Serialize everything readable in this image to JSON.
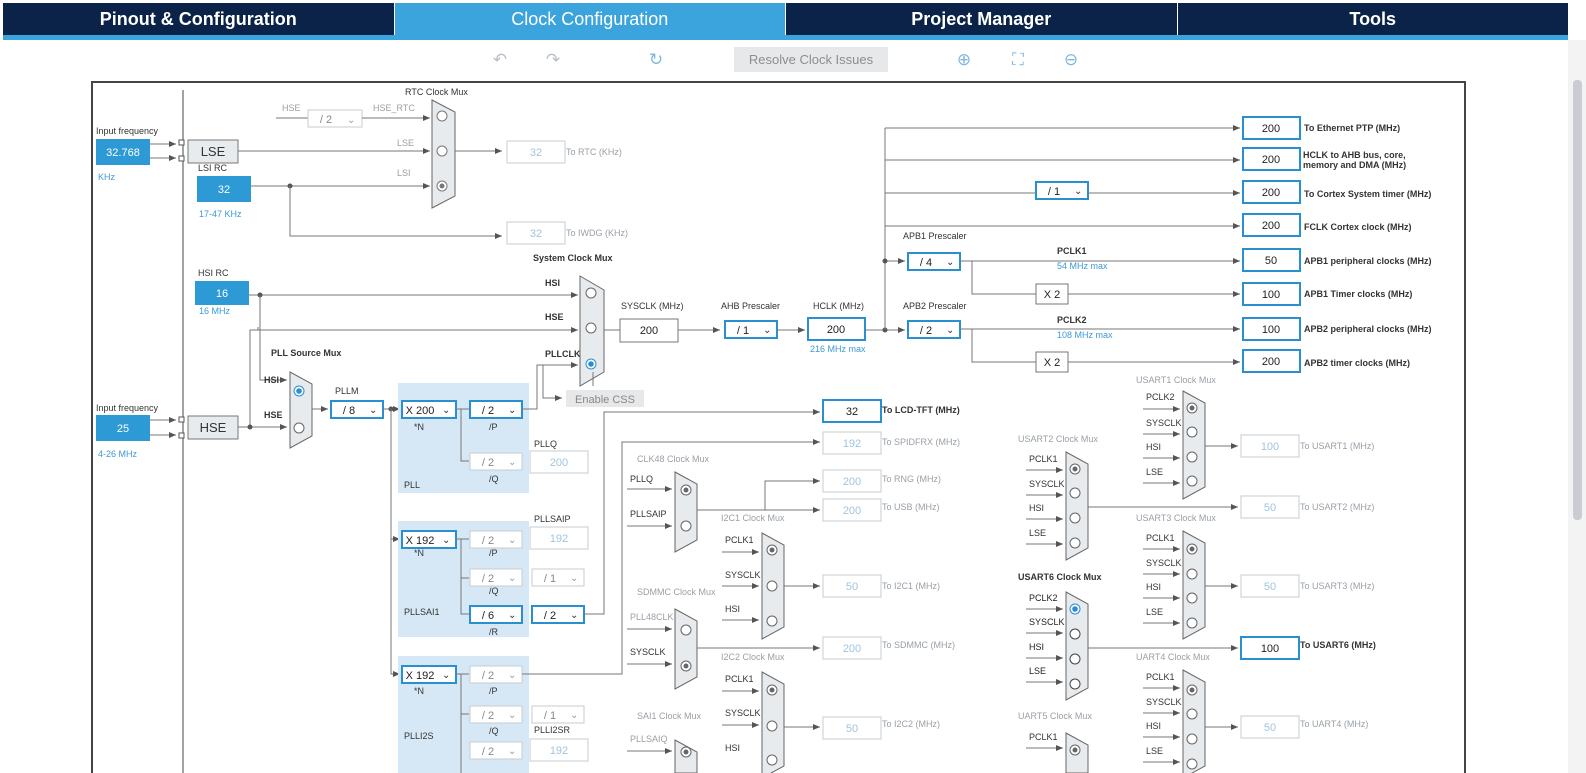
{
  "tabs": [
    "Pinout & Configuration",
    "Clock Configuration",
    "Project Manager",
    "Tools"
  ],
  "toolbar": {
    "resolve_label": "Resolve Clock Issues"
  },
  "colors": {
    "accent": "#3ba4dc",
    "nav": "#0b2349",
    "box_active": "#2a8fd0"
  },
  "sources": {
    "input_freq_label": "Input frequency",
    "lse": {
      "value": "32.768",
      "unit": "KHz",
      "label": "LSE"
    },
    "lsi": {
      "label": "LSI RC",
      "value": "32",
      "range": "17-47 KHz"
    },
    "hsi": {
      "label": "HSI RC",
      "value": "16",
      "range": "16 MHz"
    },
    "hse": {
      "value": "25",
      "range": "4-26 MHz",
      "label": "HSE"
    }
  },
  "rtc": {
    "title": "RTC Clock Mux",
    "hse": "HSE",
    "hse_div": "/ 2",
    "hse_rtc": "HSE_RTC",
    "lse": "LSE",
    "lsi": "LSI",
    "out": "32",
    "out_label": "To RTC (KHz)",
    "iwdg": "32",
    "iwdg_label": "To IWDG (KHz)"
  },
  "sysmux": {
    "title": "System Clock Mux",
    "hsi": "HSI",
    "hse": "HSE",
    "pllclk": "PLLCLK",
    "sysclk_label": "SYSCLK (MHz)",
    "sysclk": "200",
    "css": "Enable CSS"
  },
  "ahb": {
    "label": "AHB Prescaler",
    "div": "/ 1",
    "hclk_label": "HCLK (MHz)",
    "hclk": "200",
    "max": "216 MHz max"
  },
  "apb1": {
    "label": "APB1 Prescaler",
    "div": "/ 4",
    "pclk": "PCLK1",
    "max": "54 MHz max",
    "x2": "X 2"
  },
  "apb2": {
    "label": "APB2 Prescaler",
    "div": "/ 2",
    "pclk": "PCLK2",
    "max": "108 MHz max",
    "x2": "X 2"
  },
  "cortex_div": "/ 1",
  "outputs": [
    {
      "value": "200",
      "label": "To Ethernet PTP (MHz)"
    },
    {
      "value": "200",
      "label": "HCLK to AHB bus, core, memory and DMA (MHz)"
    },
    {
      "value": "200",
      "label": "To Cortex System timer (MHz)"
    },
    {
      "value": "200",
      "label": "FCLK Cortex clock (MHz)"
    },
    {
      "value": "50",
      "label": "APB1 peripheral clocks (MHz)"
    },
    {
      "value": "100",
      "label": "APB1 Timer clocks (MHz)"
    },
    {
      "value": "100",
      "label": "APB2 peripheral clocks (MHz)"
    },
    {
      "value": "200",
      "label": "APB2 timer clocks (MHz)"
    }
  ],
  "pll": {
    "src_title": "PLL Source Mux",
    "hsi": "HSI",
    "hse": "HSE",
    "pllm_label": "PLLM",
    "pllm": "/ 8",
    "n": "X 200",
    "n_lab": "*N",
    "p": "/ 2",
    "p_lab": "/P",
    "q": "/ 2",
    "q_lab": "/Q",
    "plllq": "PLLQ",
    "plllq_val": "200",
    "name": "PLL"
  },
  "pllsai": {
    "n": "X 192",
    "n_lab": "*N",
    "p": "/ 2",
    "p_lab": "/P",
    "q": "/ 2",
    "q_lab": "/Q",
    "qdiv": "/ 1",
    "r": "/ 6",
    "r_lab": "/R",
    "rdiv": "/ 2",
    "pllsaip": "PLLSAIP",
    "pllsaip_val": "192",
    "name": "PLLSAI1"
  },
  "plli2s": {
    "n": "X 192",
    "n_lab": "*N",
    "p": "/ 2",
    "p_lab": "/P",
    "q": "/ 2",
    "q_lab": "/Q",
    "qdiv": "/ 1",
    "r": "/ 2",
    "name": "PLLI2S",
    "plli2sr": "PLLI2SR",
    "plli2sr_val": "192"
  },
  "lcd": {
    "value": "32",
    "label": "To LCD-TFT (MHz)"
  },
  "spdif": {
    "value": "192",
    "label": "To SPIDFRX (MHz)"
  },
  "clk48": {
    "title": "CLK48 Clock Mux",
    "pllq": "PLLQ",
    "pllsaip": "PLLSAIP",
    "rng": "200",
    "rng_label": "To RNG (MHz)",
    "usb": "200",
    "usb_label": "To USB (MHz)"
  },
  "i2c1": {
    "title": "I2C1 Clock Mux",
    "a": "PCLK1",
    "b": "SYSCLK",
    "c": "HSI",
    "value": "50",
    "label": "To I2C1 (MHz)"
  },
  "sdmmc": {
    "title": "SDMMC Clock Mux",
    "a": "PLL48CLK",
    "b": "SYSCLK",
    "value": "200",
    "label": "To SDMMC (MHz)"
  },
  "i2c2": {
    "title": "I2C2 Clock Mux",
    "a": "PCLK1",
    "b": "SYSCLK",
    "c": "HSI",
    "value": "50",
    "label": "To I2C2 (MHz)"
  },
  "sai1": {
    "title": "SAI1 Clock Mux",
    "a": "PLLSAIQ"
  },
  "usart1": {
    "title": "USART1 Clock Mux",
    "a": "PCLK2",
    "b": "SYSCLK",
    "c": "HSI",
    "d": "LSE",
    "value": "100",
    "label": "To USART1 (MHz)"
  },
  "usart2": {
    "title": "USART2 Clock Mux",
    "a": "PCLK1",
    "b": "SYSCLK",
    "c": "HSI",
    "d": "LSE",
    "value": "50",
    "label": "To USART2 (MHz)"
  },
  "usart3": {
    "title": "USART3 Clock Mux",
    "a": "PCLK1",
    "b": "SYSCLK",
    "c": "HSI",
    "d": "LSE",
    "value": "50",
    "label": "To USART3 (MHz)"
  },
  "usart6": {
    "title": "USART6 Clock Mux",
    "a": "PCLK2",
    "b": "SYSCLK",
    "c": "HSI",
    "d": "LSE",
    "value": "100",
    "label": "To USART6 (MHz)"
  },
  "uart4": {
    "title": "UART4 Clock Mux",
    "a": "PCLK1",
    "b": "SYSCLK",
    "c": "HSI",
    "d": "LSE",
    "value": "50",
    "label": "To UART4 (MHz)"
  },
  "uart5": {
    "title": "UART5 Clock Mux",
    "a": "PCLK1"
  }
}
